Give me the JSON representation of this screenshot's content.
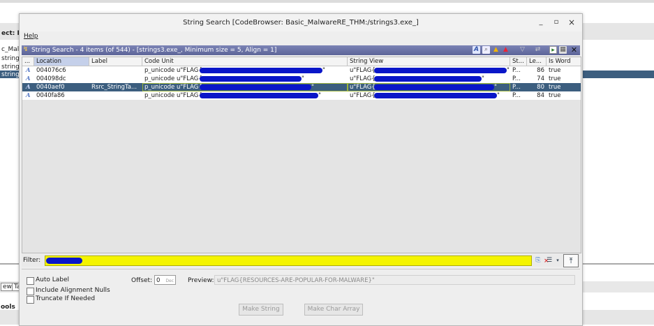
{
  "background": {
    "left_texts": [
      "ect: E",
      "c_Malw",
      "strings:",
      "strings:",
      "strings"
    ],
    "bottom_left_texts": [
      "ew",
      "Ta",
      "ools"
    ]
  },
  "window": {
    "title": "String Search [CodeBrowser: Basic_MalwareRE_THM:/strings3.exe_]",
    "controls": {
      "minimize": "_",
      "maximize": "▫",
      "close": "×"
    },
    "menu": "Help"
  },
  "panel": {
    "header": "String Search - 4 items (of 544) - [strings3.exe_, Minimum size = 5, Align = 1]",
    "toolbar_icons": [
      "string-icon",
      "search-icon",
      "warning-icon",
      "error-icon",
      "filter-icon",
      "refresh-icon",
      "snapshot-icon",
      "window-icon",
      "close-icon"
    ]
  },
  "table": {
    "columns": [
      "...",
      "Location",
      "Label",
      "Code Unit",
      "String View",
      "St...",
      "Le...",
      "Is Word"
    ],
    "rows": [
      {
        "icon": "A",
        "location": "004076c6",
        "label": "",
        "code_unit": "p_unicode u\"FLAG{",
        "code_end": "\"",
        "string_view": "u\"FLAG{",
        "sv_end": "\"",
        "st": "P...",
        "len": "86",
        "is_word": "true"
      },
      {
        "icon": "A",
        "location": "004098dc",
        "label": "",
        "code_unit": "p_unicode u\"FLAG{",
        "code_end": "\"",
        "string_view": "u\"FLAG{",
        "sv_end": "\"",
        "st": "P...",
        "len": "74",
        "is_word": "true"
      },
      {
        "icon": "A",
        "location": "0040aef0",
        "label": "Rsrc_StringTa...",
        "code_unit": "p_unicode u\"FLAG{",
        "code_end": "\"",
        "string_view": "u\"FLAG{",
        "sv_end": "\"",
        "st": "P...",
        "len": "80",
        "is_word": "true"
      },
      {
        "icon": "A",
        "location": "0040fa86",
        "label": "",
        "code_unit": "p_unicode u\"FLAG{",
        "code_end": "\"",
        "string_view": "u\"FLAG{",
        "sv_end": "\"",
        "st": "P...",
        "len": "84",
        "is_word": "true"
      }
    ],
    "selected_row": 2
  },
  "filter": {
    "label": "Filter:",
    "value": "",
    "clear": "×",
    "pin": "⤒"
  },
  "options": {
    "auto_label": "Auto Label",
    "include_alignment_nulls": "Include Alignment Nulls",
    "truncate_if_needed": "Truncate If Needed",
    "offset_label": "Offset:",
    "offset_value": "0",
    "offset_hint": "Dec",
    "preview_label": "Preview:",
    "preview_value": "u\"FLAG{RESOURCES-ARE-POPULAR-FOR-MALWARE}\"",
    "make_string": "Make String",
    "make_char_array": "Make Char Array"
  },
  "colors": {
    "selection": "#3c5e7f",
    "filter_bg": "#f4f400",
    "header_bar": "#5c6498",
    "redaction": "#0a16c8"
  }
}
